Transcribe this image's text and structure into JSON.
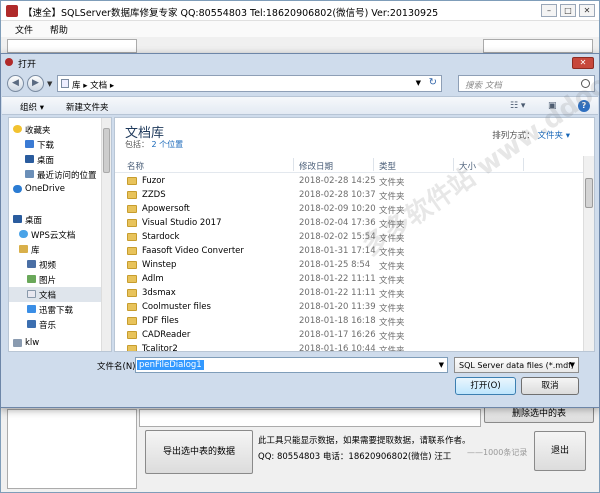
{
  "app": {
    "title": "【速全】SQLServer数据库修复专家   QQ:80554803 Tel:18620906802(微信号)   Ver:20130925",
    "menu": [
      "文件",
      "帮助"
    ],
    "buttons": {
      "delete_selected": "删除选中的表",
      "export_selected": "导出选中表的数据",
      "exit": "退出"
    },
    "info_line1": "此工具只能显示数据，如果需要提取数据，请联系作者。",
    "info_line2": "QQ:  80554803    电话：18620906802(微信) 汪工",
    "record_hint": "——1000条记录"
  },
  "dialog": {
    "title": "打开",
    "address_path": "库 ▸ 文档 ▸",
    "search_placeholder": "搜索 文档",
    "toolbar": {
      "organize": "组织 ▾",
      "new_folder": "新建文件夹"
    },
    "nav": [
      "收藏夹",
      "下载",
      "桌面",
      "最近访问的位置",
      "OneDrive",
      "桌面",
      "WPS云文档",
      "库",
      "视频",
      "图片",
      "文档",
      "迅雷下载",
      "音乐",
      "klw"
    ],
    "library_title": "文档库",
    "library_includes": "包括：",
    "library_link": "2 个位置",
    "arrange_label": "排列方式：",
    "arrange_value": "文件夹 ▾",
    "columns": [
      "名称",
      "修改日期",
      "类型",
      "大小"
    ],
    "files": [
      {
        "name": "Fuzor",
        "date": "2018-02-28 14:25",
        "type": "文件夹"
      },
      {
        "name": "ZZDS",
        "date": "2018-02-28 10:37",
        "type": "文件夹"
      },
      {
        "name": "Apowersoft",
        "date": "2018-02-09 10:20",
        "type": "文件夹"
      },
      {
        "name": "Visual Studio 2017",
        "date": "2018-02-04 17:36",
        "type": "文件夹"
      },
      {
        "name": "Stardock",
        "date": "2018-02-02 15:54",
        "type": "文件夹"
      },
      {
        "name": "Faasoft Video Converter",
        "date": "2018-01-31 17:14",
        "type": "文件夹"
      },
      {
        "name": "Winstep",
        "date": "2018-01-25 8:54",
        "type": "文件夹"
      },
      {
        "name": "Adlm",
        "date": "2018-01-22 11:11",
        "type": "文件夹"
      },
      {
        "name": "3dsmax",
        "date": "2018-01-22 11:11",
        "type": "文件夹"
      },
      {
        "name": "Coolmuster files",
        "date": "2018-01-20 11:39",
        "type": "文件夹"
      },
      {
        "name": "PDF files",
        "date": "2018-01-18 16:18",
        "type": "文件夹"
      },
      {
        "name": "CADReader",
        "date": "2018-01-17 16:26",
        "type": "文件夹"
      },
      {
        "name": "Tcalitor2",
        "date": "2018-01-16 10:44",
        "type": "文件夹"
      }
    ],
    "filename_label": "文件名(N):",
    "filename_value": "penFileDialog1",
    "filetype_value": "SQL Server data files (*.mdf;",
    "open_button": "打开(O)",
    "cancel_button": "取消"
  },
  "watermark": "多多软件站  www.ddooo.com"
}
